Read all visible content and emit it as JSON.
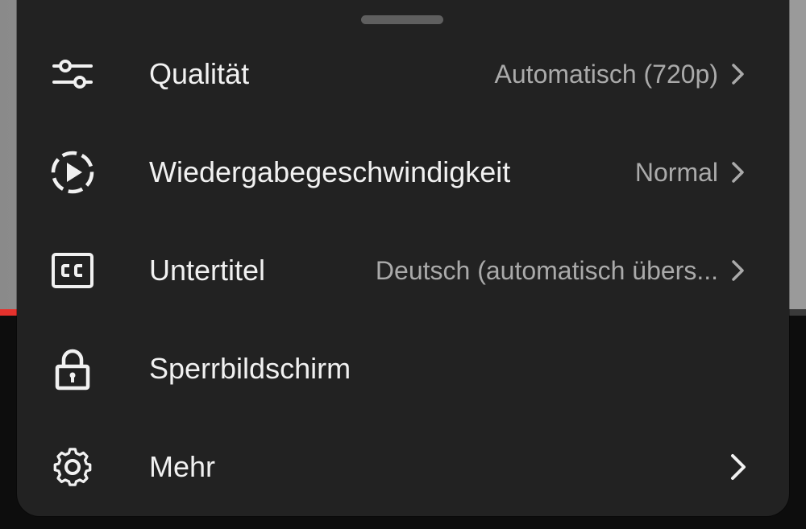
{
  "menu": {
    "items": [
      {
        "icon": "sliders-icon",
        "label": "Qualität",
        "value": "Automatisch (720p)",
        "has_chevron": true
      },
      {
        "icon": "playback-speed-icon",
        "label": "Wiedergabegeschwindigkeit",
        "value": "Normal",
        "has_chevron": true
      },
      {
        "icon": "closed-captions-icon",
        "label": "Untertitel",
        "value": "Deutsch (automatisch übers...",
        "has_chevron": true
      },
      {
        "icon": "lock-icon",
        "label": "Sperrbildschirm",
        "value": "",
        "has_chevron": false
      },
      {
        "icon": "gear-icon",
        "label": "Mehr",
        "value": "",
        "has_chevron": true
      }
    ]
  },
  "colors": {
    "sheet_background": "#222222",
    "label_text": "#f1f1f1",
    "value_text": "#aaaaaa",
    "progress_accent": "#e5322d"
  }
}
